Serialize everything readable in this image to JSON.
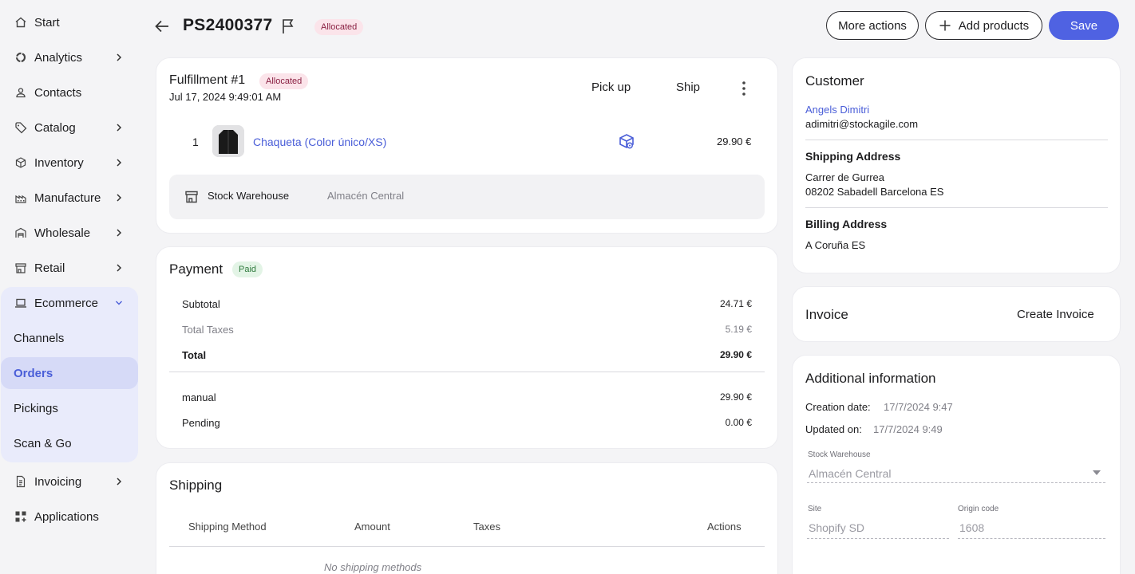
{
  "sidebar": {
    "items": [
      {
        "label": "Start",
        "icon": "home-icon"
      },
      {
        "label": "Analytics",
        "icon": "analytics-icon"
      },
      {
        "label": "Contacts",
        "icon": "contacts-icon"
      },
      {
        "label": "Catalog",
        "icon": "tag-icon"
      },
      {
        "label": "Inventory",
        "icon": "box-icon"
      },
      {
        "label": "Manufacture",
        "icon": "factory-icon"
      },
      {
        "label": "Wholesale",
        "icon": "warehouse-icon"
      },
      {
        "label": "Retail",
        "icon": "store-icon"
      },
      {
        "label": "Ecommerce",
        "icon": "laptop-icon"
      },
      {
        "label": "Invoicing",
        "icon": "document-icon"
      },
      {
        "label": "Applications",
        "icon": "apps-icon"
      }
    ],
    "ecommerce_sub": [
      "Channels",
      "Orders",
      "Pickings",
      "Scan & Go"
    ],
    "active_sub": "Orders"
  },
  "header": {
    "order_id": "PS2400377",
    "status": "Allocated",
    "more_actions": "More actions",
    "add_products": "Add products",
    "save": "Save"
  },
  "fulfillment": {
    "title": "Fulfillment #1",
    "status": "Allocated",
    "date": "Jul 17, 2024 9:49:01 AM",
    "pick_up": "Pick up",
    "ship": "Ship",
    "line": {
      "qty": "1",
      "product": "Chaqueta (Color único/XS)",
      "price": "29.90 €"
    },
    "warehouse_label": "Stock Warehouse",
    "warehouse_value": "Almacén Central"
  },
  "payment": {
    "title": "Payment",
    "status": "Paid",
    "subtotal_label": "Subtotal",
    "subtotal": "24.71 €",
    "taxes_label": "Total Taxes",
    "taxes": "5.19 €",
    "total_label": "Total",
    "total": "29.90 €",
    "manual_label": "manual",
    "manual": "29.90 €",
    "pending_label": "Pending",
    "pending": "0.00 €"
  },
  "shipping": {
    "title": "Shipping",
    "columns": [
      "Shipping Method",
      "Amount",
      "Taxes",
      "Actions"
    ],
    "empty": "No shipping methods"
  },
  "customer": {
    "title": "Customer",
    "name": "Angels Dimitri",
    "email": "adimitri@stockagile.com",
    "shipping_title": "Shipping Address",
    "shipping_line1": "Carrer de Gurrea",
    "shipping_line2": "08202 Sabadell Barcelona ES",
    "billing_title": "Billing Address",
    "billing_line1": "A Coruña ES"
  },
  "invoice": {
    "title": "Invoice",
    "action": "Create Invoice"
  },
  "additional": {
    "title": "Additional information",
    "creation_label": "Creation date:",
    "creation": "17/7/2024 9:47",
    "updated_label": "Updated on:",
    "updated": "17/7/2024 9:49",
    "warehouse_label": "Stock Warehouse",
    "warehouse": "Almacén Central",
    "site_label": "Site",
    "site": "Shopify SD",
    "origin_label": "Origin code",
    "origin": "1608"
  },
  "colors": {
    "accent": "#4f62e2",
    "link": "#4a5ed8",
    "allocated_bg": "#fbe4ea",
    "paid_bg": "#e3f4e6"
  }
}
